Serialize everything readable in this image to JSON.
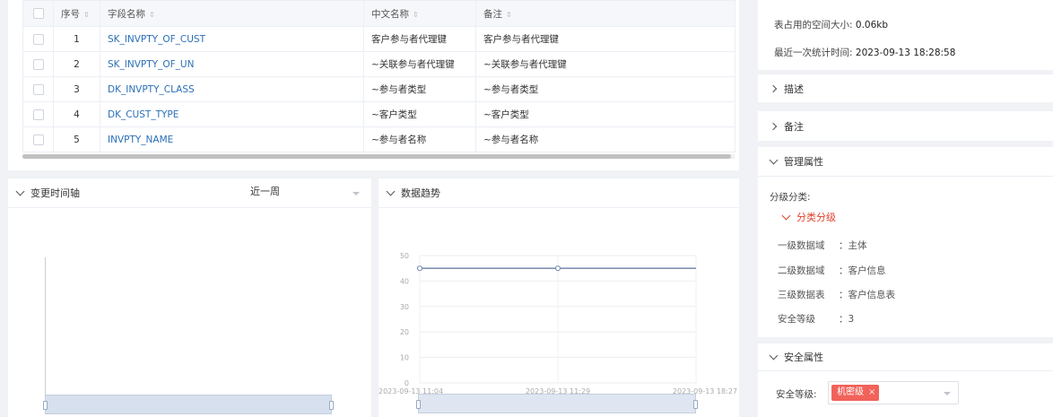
{
  "table": {
    "headers": [
      "序号",
      "字段名称",
      "中文名称",
      "备注"
    ],
    "rows": [
      {
        "no": "1",
        "name": "SK_INVPTY_OF_CUST",
        "cn": "客户参与者代理键",
        "note": "客户参与者代理键"
      },
      {
        "no": "2",
        "name": "SK_INVPTY_OF_UN",
        "cn": "~关联参与者代理键",
        "note": "~关联参与者代理键"
      },
      {
        "no": "3",
        "name": "DK_INVPTY_CLASS",
        "cn": "~参与者类型",
        "note": "~参与者类型"
      },
      {
        "no": "4",
        "name": "DK_CUST_TYPE",
        "cn": "~客户类型",
        "note": "~客户类型"
      },
      {
        "no": "5",
        "name": "INVPTY_NAME",
        "cn": "~参与者名称",
        "note": "~参与者名称"
      }
    ]
  },
  "timeline": {
    "title": "变更时间轴",
    "period": "近一周"
  },
  "trend": {
    "title": "数据趋势",
    "chart_data": {
      "type": "line",
      "x": [
        "2023-09-13 11:04",
        "2023-09-13 11:29",
        "2023-09-13 18:27"
      ],
      "y": [
        45,
        45,
        45
      ],
      "yticks": [
        0,
        10,
        20,
        30,
        40,
        50
      ],
      "ylim": [
        0,
        50
      ],
      "xlabels": [
        "2023-09-13 11:04",
        "2023-09-13 11:29",
        "2023-09-13 18:27"
      ],
      "marker_indices": [
        0,
        1
      ],
      "line_color": "#7f93b5",
      "grid": true
    }
  },
  "right": {
    "space_label": "表占用的空间大小:",
    "space_value": "0.06kb",
    "stat_label": "最近一次统计时间:",
    "stat_value": "2023-09-13 18:28:58",
    "desc_title": "描述",
    "remark_title": "备注",
    "mgmt_title": "管理属性",
    "classification_label": "分级分类:",
    "classification_group": "分类分级",
    "attrs": [
      {
        "k": "一级数据域",
        "v": "：主体"
      },
      {
        "k": "二级数据域",
        "v": "：客户信息"
      },
      {
        "k": "三级数据表",
        "v": "：客户信息表"
      },
      {
        "k": "安全等级",
        "v": "：3"
      }
    ],
    "security_title": "安全属性",
    "security_label": "安全等级:",
    "security_tag": "机密级",
    "security_tag_remove": "×",
    "accent_color": "#e0412c",
    "tag_color": "#f1625a"
  }
}
